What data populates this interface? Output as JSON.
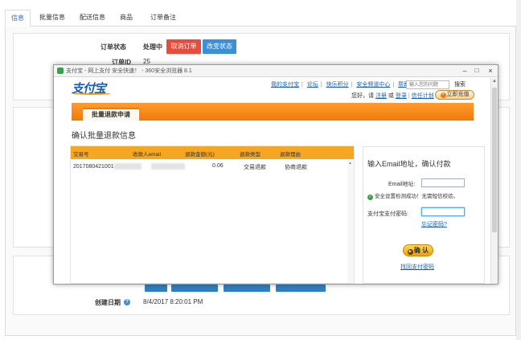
{
  "tabs": [
    "信息",
    "批量信息",
    "配送信息",
    "商品",
    "订单备注"
  ],
  "order": {
    "status_label": "订单状态",
    "status_value": "处理中",
    "cancel_button": "取消订单",
    "change_status_button": "改变状态",
    "id_label": "订单ID",
    "id_value": "25",
    "created_label": "创建日期",
    "created_value": "8/4/2017 8:20:01 PM"
  },
  "popup": {
    "window_title": "支付宝 - 网上支付 安全快速！ - 360安全浏览器 8.1",
    "controls": {
      "minimize": "–",
      "maximize": "□",
      "close": "×"
    },
    "logo": "支付宝",
    "topnav": [
      "我的支付宝",
      "论坛",
      "快乐积分",
      "安全频道中心",
      "帮助中心"
    ],
    "search_placeholder": "输入您的问题",
    "search_button": "搜索",
    "greeting": "您好，请",
    "login": "注册",
    "or": "或",
    "register": "登录",
    "credit_plan": "信任计划",
    "recharge_button": "立即充值",
    "tab_label": "批量退款申请",
    "section_title": "确认批量退款信息",
    "table": {
      "headers": [
        "交易号",
        "收款人email",
        "退款金额(元)",
        "退款类型",
        "退款理由"
      ],
      "rows": [
        {
          "trade_no": "2017080421001",
          "email": "·········taobao·",
          "amount": "0.06",
          "type": "交易退款",
          "reason": "协商退款"
        }
      ]
    },
    "pay": {
      "title": "输入Email地址，确认付款",
      "email_label": "Email地址:",
      "security_check": "安全设置检测成功！无需短信校验。",
      "password_label": "支付宝支付密码:",
      "forgot_link": "忘记密码?",
      "confirm_button": "确 认",
      "find_password_link": "找回支付密码"
    }
  }
}
